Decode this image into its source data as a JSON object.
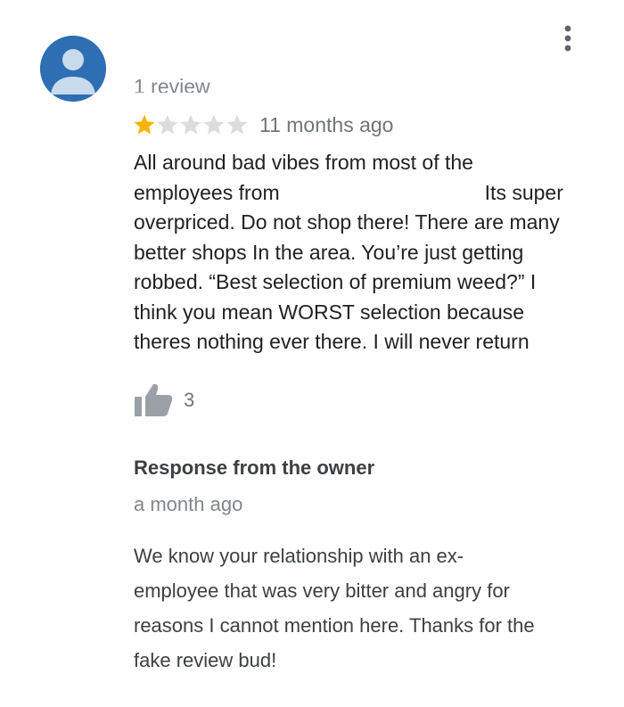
{
  "reviewer": {
    "avatar_icon": "person-avatar-icon",
    "avatar_color": "#2d6fb2",
    "review_count": "1 review"
  },
  "menu": {
    "icon": "more-vertical-icon"
  },
  "review": {
    "rating": 1,
    "max_rating": 5,
    "star_filled_color": "#f4b400",
    "star_empty_color": "#dadce0",
    "time": "11 months ago",
    "text_lines": [
      "All around bad vibes from most of the",
      "employees from                                    Its super",
      "overpriced. Do not shop there! There are many",
      "better shops In the area. You’re just getting",
      "robbed. “Best selection of premium weed?” I",
      "think you mean WORST selection because",
      "theres nothing ever there. I will never return"
    ],
    "likes": "3",
    "like_icon": "thumbs-up-icon"
  },
  "owner_response": {
    "heading": "Response from the owner",
    "time": "a month ago",
    "text_lines": [
      "We know your relationship with an ex-",
      "employee that was very bitter and angry for",
      "reasons I cannot mention here. Thanks for the",
      "fake review bud!"
    ]
  }
}
